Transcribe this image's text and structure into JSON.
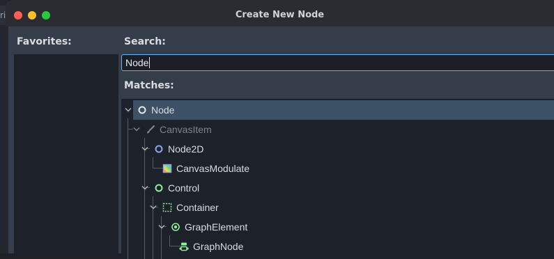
{
  "window": {
    "title": "Create New Node"
  },
  "background_tab": {
    "label": "rip"
  },
  "favorites": {
    "label": "Favorites:"
  },
  "search": {
    "label": "Search:",
    "value": "Node"
  },
  "matches": {
    "label": "Matches:",
    "items": [
      {
        "label": "Node",
        "icon": "node-icon",
        "selected": true,
        "depth": 0
      },
      {
        "label": "CanvasItem",
        "icon": "brush-icon",
        "dim": true,
        "depth": 1
      },
      {
        "label": "Node2D",
        "icon": "node2d-icon",
        "depth": 2
      },
      {
        "label": "CanvasModulate",
        "icon": "canvas-modulate-icon",
        "depth": 3
      },
      {
        "label": "Control",
        "icon": "control-icon",
        "depth": 2
      },
      {
        "label": "Container",
        "icon": "container-icon",
        "depth": 3
      },
      {
        "label": "GraphElement",
        "icon": "graph-element-icon",
        "depth": 4
      },
      {
        "label": "GraphNode",
        "icon": "graph-node-icon",
        "depth": 5
      }
    ]
  },
  "colors": {
    "accent": "#6cb0e8",
    "selection": "#3c5166",
    "node2d": "#8da5f3",
    "control": "#8eef97"
  }
}
